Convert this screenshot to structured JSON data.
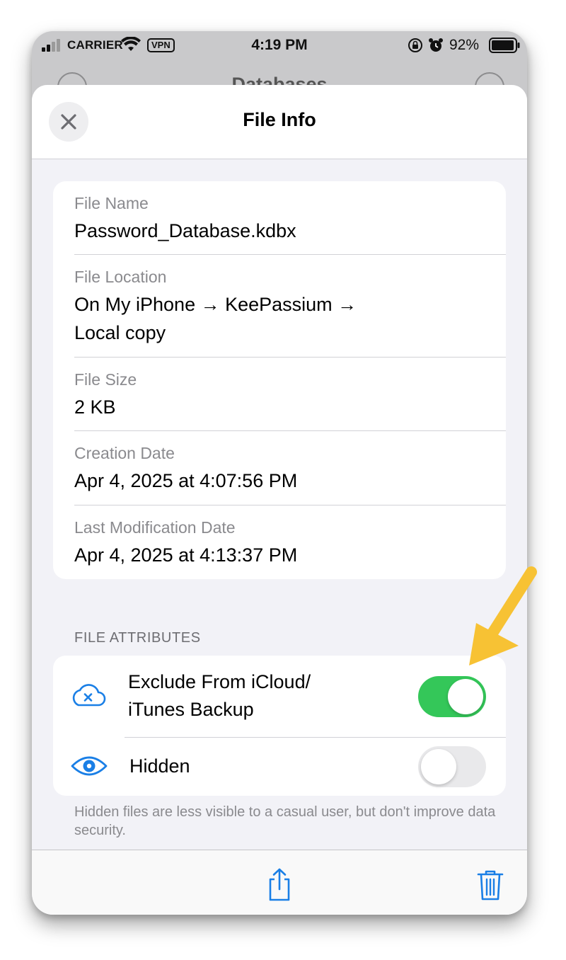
{
  "status_bar": {
    "carrier": "CARRIER",
    "vpn": "VPN",
    "time": "4:19 PM",
    "battery_percent": "92%",
    "icons": [
      "signal-icon",
      "wifi-icon",
      "orientation-lock-icon",
      "alarm-icon",
      "battery-icon"
    ]
  },
  "background": {
    "title": "Databases"
  },
  "sheet": {
    "title": "File Info",
    "close_icon": "close-icon"
  },
  "file_info": {
    "rows": [
      {
        "label": "File Name",
        "value": "Password_Database.kdbx"
      },
      {
        "label": "File Location",
        "value_line1": "On My iPhone → KeePassium →",
        "value_line2": "Local copy"
      },
      {
        "label": "File Size",
        "value": "2 KB"
      },
      {
        "label": "Creation Date",
        "value": "Apr 4, 2025 at 4:07:56 PM"
      },
      {
        "label": "Last Modification Date",
        "value": "Apr 4, 2025 at 4:13:37 PM"
      }
    ]
  },
  "attributes": {
    "header": "FILE ATTRIBUTES",
    "exclude_backup": {
      "label_line1": "Exclude From iCloud/",
      "label_line2": "iTunes Backup",
      "icon": "cloud-x-icon",
      "enabled": true
    },
    "hidden": {
      "label": "Hidden",
      "icon": "eye-icon",
      "enabled": false
    },
    "footer": "Hidden files are less visible to a casual user, but don't improve data security."
  },
  "toolbar": {
    "share_icon": "share-icon",
    "trash_icon": "trash-icon"
  },
  "colors": {
    "accent": "#1a7fe6",
    "toggle_on": "#34c759",
    "toggle_off": "#e9e9eb",
    "annotation_arrow": "#f7c234"
  }
}
